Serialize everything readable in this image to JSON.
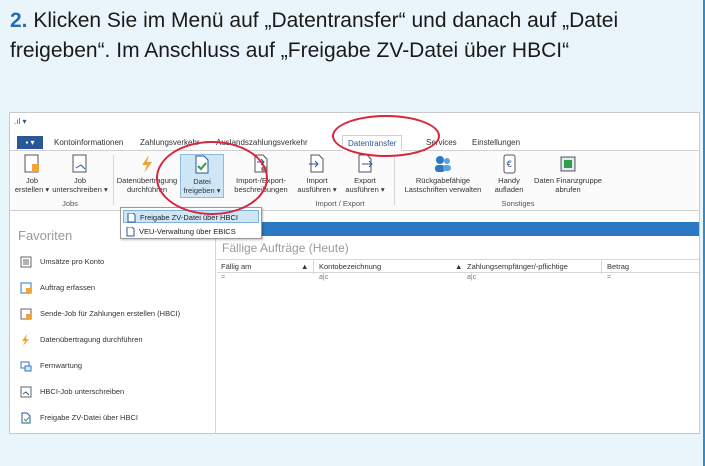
{
  "instruction": {
    "number": "2.",
    "text": " Klicken Sie im Menü auf „Datentransfer“ und danach auf „Datei freigeben“. Im Anschluss auf „Freigabe ZV-Datei über HBCI“"
  },
  "colors": {
    "accent": "#2b5797",
    "highlight_circle": "#d7263d",
    "frame_border": "#2e8fc9"
  },
  "quick_access": {
    "label": ".ıl ▾"
  },
  "ribbon_tabs": {
    "file": "▪ ▾",
    "items": [
      "Kontoinformationen",
      "Zahlungsverkehr",
      "Auslandszahlungsverkehr",
      "Datentransfer",
      "Services",
      "Einstellungen"
    ],
    "active": "Datentransfer"
  },
  "ribbon": {
    "buttons": [
      {
        "line1": "Job",
        "line2": "erstellen ▾",
        "icon": "job-create-icon"
      },
      {
        "line1": "Job",
        "line2": "unterschreiben ▾",
        "icon": "job-sign-icon"
      },
      {
        "line1": "Datenübertragung",
        "line2": "durchführen",
        "icon": "lightning-icon"
      },
      {
        "line1": "Datei",
        "line2": "freigeben ▾",
        "icon": "file-release-icon"
      },
      {
        "line1": "Import-/Export-",
        "line2": "beschreibungen",
        "icon": "import-export-desc-icon"
      },
      {
        "line1": "Import",
        "line2": "ausführen ▾",
        "icon": "import-icon"
      },
      {
        "line1": "Export",
        "line2": "ausführen ▾",
        "icon": "export-icon"
      },
      {
        "line1": "Rückgabefähige",
        "line2": "Lastschriften verwalten",
        "icon": "users-icon"
      },
      {
        "line1": "Handy",
        "line2": "aufladen",
        "icon": "euro-phone-icon"
      },
      {
        "line1": "Daten Finanzgruppe",
        "line2": "abrufen",
        "icon": "data-group-icon"
      }
    ],
    "groups": {
      "jobs": "Jobs",
      "import_export": "Import / Export",
      "sonstiges": "Sonstiges"
    }
  },
  "dropdown": {
    "items": [
      "Freigabe ZV-Datei über HBCI",
      "VEU-Verwaltung über EBICS"
    ]
  },
  "favorites": {
    "title": "Favoriten",
    "items": [
      "Umsätze pro Konto",
      "Auftrag erfassen",
      "Sende-Job für Zahlungen erstellen (HBCI)",
      "Datenübertragung durchführen",
      "Fernwartung",
      "HBCI-Job unterschreiben",
      "Freigabe ZV-Datei über HBCI"
    ]
  },
  "doc_tab": {
    "label": "d ×"
  },
  "grid": {
    "title": "Fällige Aufträge (Heute)",
    "columns": [
      "Fällig am",
      "Kontobezeichnung",
      "Zahlungsempfänger/-pflichtige",
      "Betrag"
    ],
    "filter": [
      "=",
      "a|c",
      "a|c",
      "="
    ]
  }
}
